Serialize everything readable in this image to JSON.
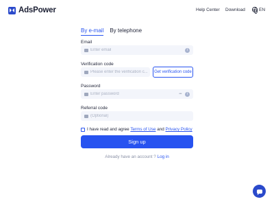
{
  "header": {
    "brand": "AdsPower",
    "nav": {
      "help": "Help Center",
      "download": "Download"
    },
    "language": "EN"
  },
  "tabs": [
    {
      "label": "By e-mail",
      "active": true
    },
    {
      "label": "By telephone",
      "active": false
    }
  ],
  "form": {
    "email": {
      "label": "Email",
      "placeholder": "Enter email",
      "value": ""
    },
    "verification": {
      "label": "Verification code",
      "placeholder": "Please enter the verification c...",
      "value": "",
      "button": "Get verification code"
    },
    "password": {
      "label": "Password",
      "placeholder": "Enter password",
      "value": "",
      "toggle": "•••"
    },
    "referral": {
      "label": "Referral code",
      "placeholder": "(Optional)",
      "value": ""
    }
  },
  "agreement": {
    "prefix": "I have read and agree",
    "terms": "Terms of Use",
    "and": "and",
    "privacy": "Privacy Policy",
    "checked": false
  },
  "submit": "Sign up",
  "footer": {
    "prompt": "Already have an account ?",
    "login": "Log in"
  },
  "colors": {
    "accent": "#2753f0",
    "brand": "#2b4acb",
    "field_bg": "#f3f5fb"
  },
  "icons": [
    "logo-icon",
    "globe-icon",
    "email-icon",
    "info-icon",
    "code-icon",
    "lock-icon",
    "eye-icon",
    "referral-icon",
    "chat-icon"
  ]
}
